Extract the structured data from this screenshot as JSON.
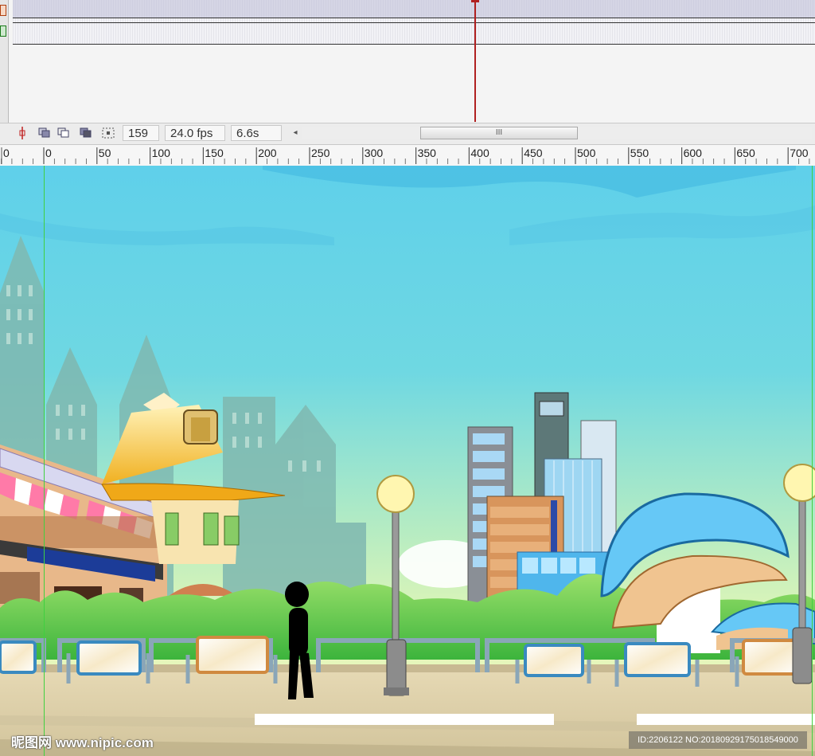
{
  "timeline": {
    "frame": "159",
    "fps": "24.0 fps",
    "time": "6.6s",
    "scroll_grip": "III",
    "scroll_left_arrow": "◂"
  },
  "ruler": {
    "labels": [
      "0",
      "0",
      "50",
      "100",
      "150",
      "200",
      "250",
      "300",
      "350",
      "400",
      "450",
      "500",
      "550",
      "600",
      "650",
      "700"
    ]
  },
  "watermark": {
    "site": "昵图网 www.nipic.com",
    "id": "ID:2206122 NO:20180929175018549000"
  }
}
